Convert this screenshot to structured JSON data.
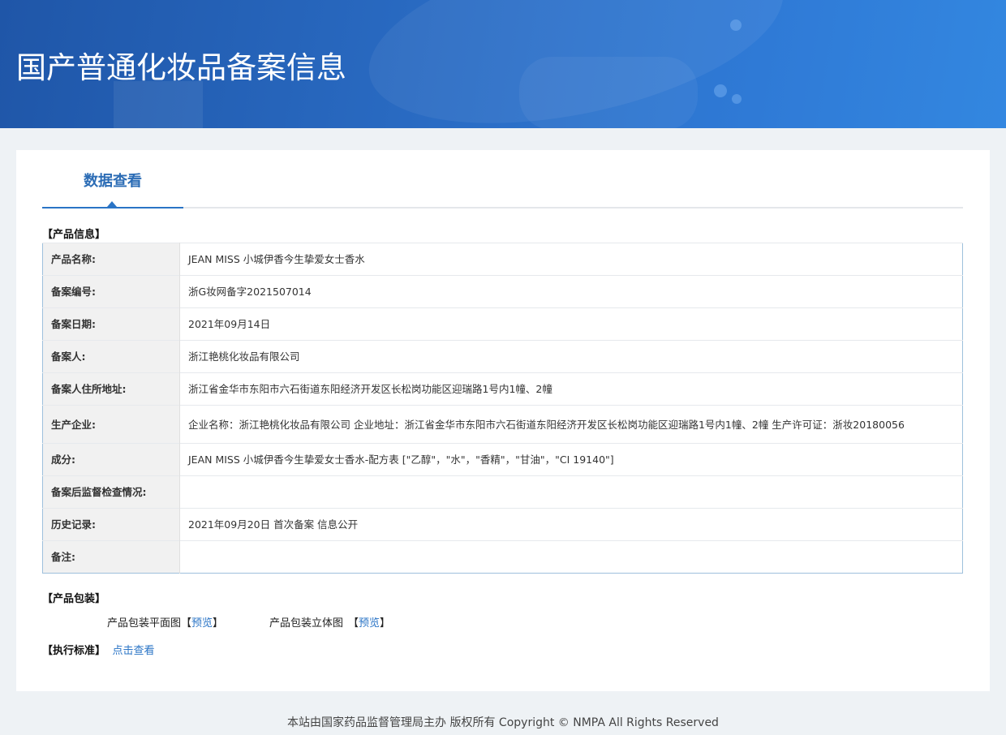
{
  "page_title": "国产普通化妆品备案信息",
  "tab": {
    "label": "数据查看"
  },
  "product_info": {
    "section_title": "【产品信息】",
    "rows": [
      {
        "key": "产品名称:",
        "value": "JEAN MISS 小城伊香今生挚爱女士香水"
      },
      {
        "key": "备案编号:",
        "value": "浙G妆网备字2021507014"
      },
      {
        "key": "备案日期:",
        "value": "2021年09月14日"
      },
      {
        "key": "备案人:",
        "value": "浙江艳桃化妆品有限公司"
      },
      {
        "key": "备案人住所地址:",
        "value": "浙江省金华市东阳市六石街道东阳经济开发区长松岗功能区迎瑞路1号内1幢、2幢"
      },
      {
        "key": "生产企业:",
        "value": "企业名称：浙江艳桃化妆品有限公司 企业地址：浙江省金华市东阳市六石街道东阳经济开发区长松岗功能区迎瑞路1号内1幢、2幢 生产许可证：浙妆20180056"
      },
      {
        "key": "成分:",
        "value": "JEAN MISS 小城伊香今生挚爱女士香水-配方表 [\"乙醇\"，\"水\"，\"香精\"，\"甘油\"，\"CI 19140\"]"
      },
      {
        "key": "备案后监督检查情况:",
        "value": ""
      },
      {
        "key": "历史记录:",
        "value": "2021年09月20日 首次备案 信息公开"
      },
      {
        "key": "备注:",
        "value": ""
      }
    ]
  },
  "packaging": {
    "section_title": "【产品包装】",
    "flat_label": "产品包装平面图",
    "flat_link": "预览",
    "stereo_label": "产品包装立体图",
    "stereo_link": "预览",
    "open_bracket": "【",
    "close_bracket": "】"
  },
  "standard": {
    "section_title": "【执行标准】",
    "link": "点击查看"
  },
  "footer": "本站由国家药品监督管理局主办 版权所有 Copyright © NMPA All Rights Reserved",
  "colors": {
    "banner": "#2a6cc4",
    "accent": "#2a74c6",
    "table_border": "#9ec0dc"
  }
}
